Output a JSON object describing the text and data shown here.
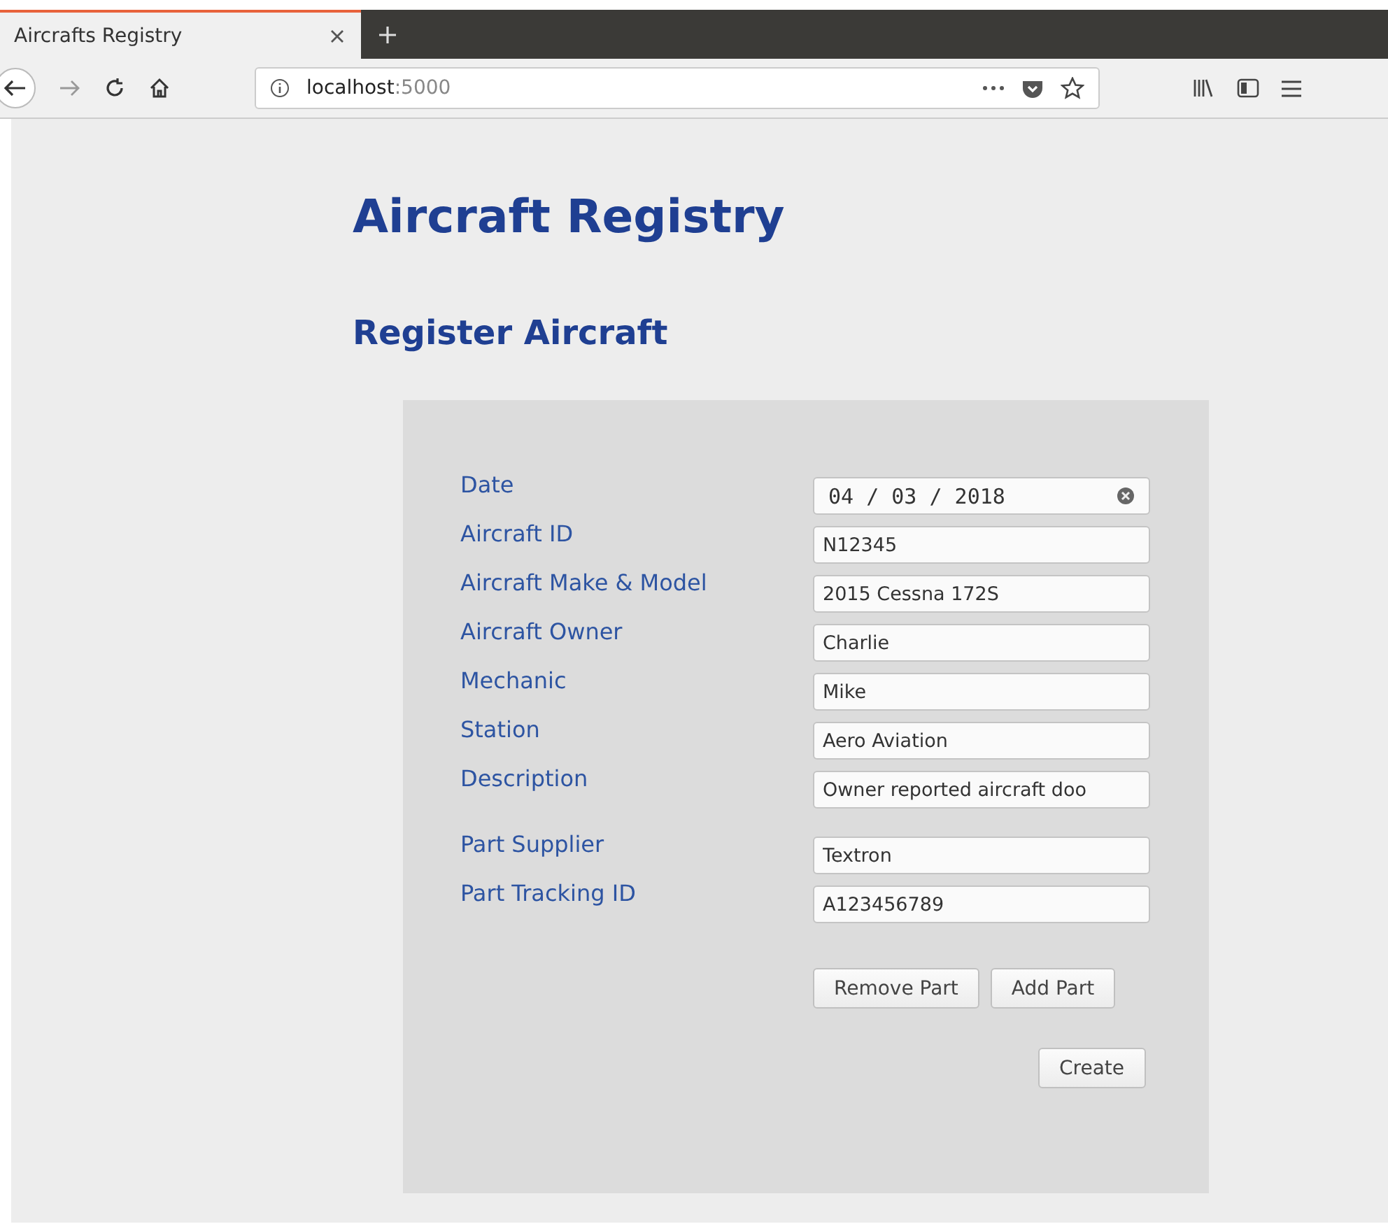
{
  "browser": {
    "tab_title": "Aircrafts Registry",
    "tab_selected": true,
    "address_host": "localhost",
    "address_port": ":5000"
  },
  "page": {
    "title": "Aircraft Registry",
    "subtitle": "Register Aircraft"
  },
  "form": {
    "groups": [
      [
        {
          "label": "Date",
          "kind": "date",
          "value": "04 / 03 / 2018"
        },
        {
          "label": "Aircraft ID",
          "kind": "text",
          "value": "N12345"
        },
        {
          "label": "Aircraft Make & Model",
          "kind": "text",
          "value": "2015 Cessna 172S"
        },
        {
          "label": "Aircraft Owner",
          "kind": "text",
          "value": "Charlie"
        },
        {
          "label": "Mechanic",
          "kind": "text",
          "value": "Mike"
        },
        {
          "label": "Station",
          "kind": "text",
          "value": "Aero Aviation"
        },
        {
          "label": "Description",
          "kind": "text",
          "value": "Owner reported aircraft doo"
        }
      ],
      [
        {
          "label": "Part Supplier",
          "kind": "text",
          "value": "Textron"
        },
        {
          "label": "Part Tracking ID",
          "kind": "text",
          "value": "A123456789"
        }
      ]
    ],
    "part_buttons": [
      "Remove Part",
      "Add Part"
    ],
    "submit": "Create"
  }
}
